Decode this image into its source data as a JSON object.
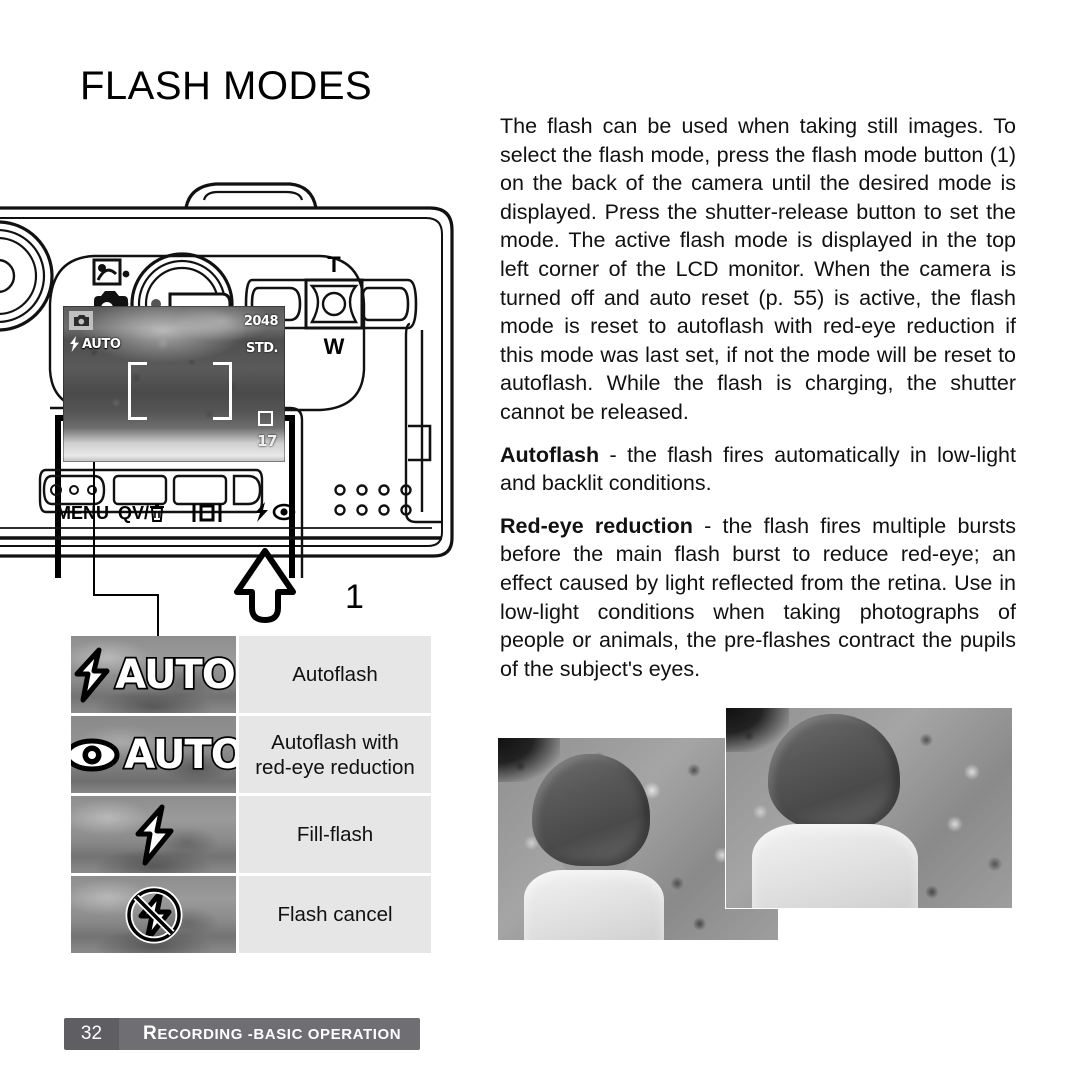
{
  "page": {
    "title": "FLASH MODES"
  },
  "body_text": {
    "paragraph_1": "The flash can be used when taking still images. To select the flash mode, press the flash mode button (1) on the back of the camera until the desired mode is displayed. Press the shutter-release button to set the mode. The active flash mode is displayed in the top left corner of the LCD monitor. When the camera is turned off and auto reset (p. 55) is active, the flash mode is reset to autoflash with red-eye reduction if this mode was last set, if not the mode will be reset to autoflash. While the flash is charging, the shutter cannot be released.",
    "autoflash_term": "Autoflash",
    "autoflash_desc": " - the flash fires automatically in low-light and backlit conditions.",
    "redeye_term": "Red-eye reduction",
    "redeye_desc": " - the flash fires multiple bursts before the main flash burst to reduce red-eye; an effect caused by light reflected from the retina. Use in low-light conditions when taking photographs of people or animals, the pre-flashes contract the pupils of the subject's eyes."
  },
  "camera": {
    "callout_number": "1",
    "zoom_tele_label": "T",
    "zoom_wide_label": "W",
    "button_labels": [
      {
        "name": "menu-button-label",
        "text": "MENU"
      },
      {
        "name": "quickview-delete-button-label",
        "text": "QV/"
      },
      {
        "name": "display-button-label",
        "text": "|O|"
      },
      {
        "name": "flash-mode-button-label",
        "text": ""
      }
    ],
    "lcd": {
      "resolution": "2048",
      "quality": "STD.",
      "flash_mode": "AUTO",
      "frame_counter": "17"
    },
    "mode_dial_icons": [
      "setup-mode-icon",
      "still-recording-mode-icon",
      "playback-mode-icon",
      "movie-audio-recording-mode-icon"
    ]
  },
  "flash_mode_table": {
    "rows": [
      {
        "icon": "autoflash-icon",
        "glyph": "bolt",
        "word": "AUTO",
        "label": "Autoflash"
      },
      {
        "icon": "autoflash-redeye-icon",
        "glyph": "eye",
        "word": "AUTO",
        "label": "Autoflash with\nred-eye reduction"
      },
      {
        "icon": "fill-flash-icon",
        "glyph": "bolt",
        "word": "",
        "label": "Fill-flash"
      },
      {
        "icon": "flash-cancel-icon",
        "glyph": "bolt-crossed",
        "word": "",
        "label": "Flash cancel"
      }
    ]
  },
  "sample_photos": [
    {
      "name": "photo-without-red-eye-reduction",
      "caption": ""
    },
    {
      "name": "photo-with-red-eye-reduction",
      "caption": ""
    }
  ],
  "footer": {
    "page_number": "32",
    "section_first_letter": "R",
    "section_rest": "ECORDING - ",
    "section_tail": "BASIC OPERATION"
  },
  "colors": {
    "footer_bar": "#6e6e73",
    "footer_page_block": "#5e5e63",
    "label_cell": "#e6e6e6",
    "icon_cell": "#8e8e8e"
  }
}
